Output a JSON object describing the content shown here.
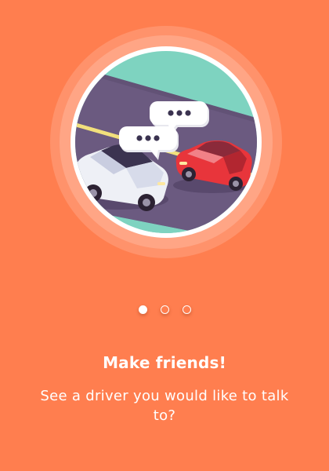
{
  "onboarding": {
    "title": "Make friends!",
    "subtitle": "See a driver you would like to talk to?",
    "pager": {
      "pages": 3,
      "active_index": 0
    },
    "illustration": {
      "icon": "cars-chatting-illustration"
    }
  },
  "colors": {
    "background": "#FF7E4F",
    "road": "#6B5A80",
    "grass": "#7ED3C0",
    "lane_line": "#F2E07C",
    "car_red": "#E8353B",
    "car_white": "#EEF0F6"
  }
}
